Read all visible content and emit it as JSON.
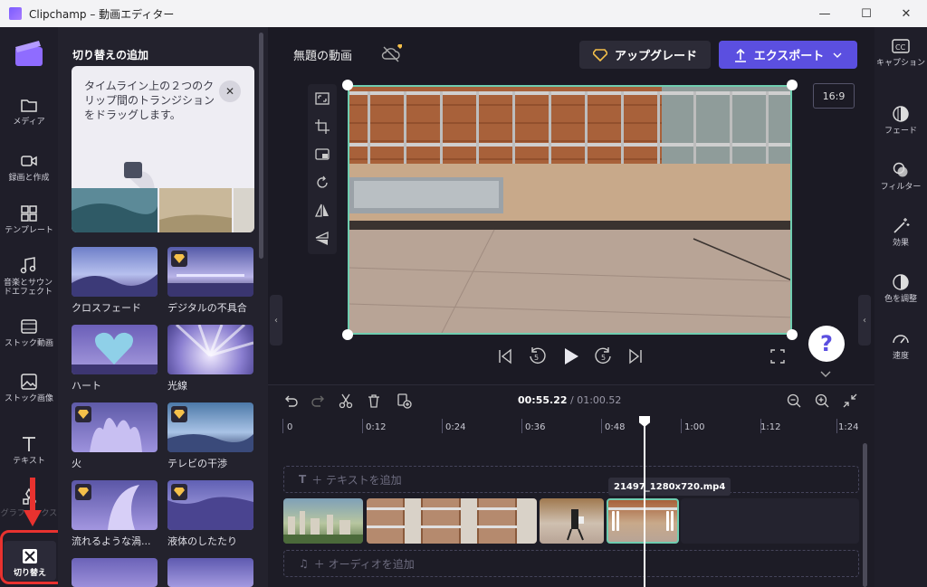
{
  "window": {
    "title": "Clipchamp – 動画エディター",
    "controls": [
      "minimize-icon",
      "maximize-icon",
      "close-icon"
    ]
  },
  "leftnav": {
    "items": [
      {
        "label": "メディア",
        "icon": "folder-icon"
      },
      {
        "label": "録画と作成",
        "icon": "camera-icon"
      },
      {
        "label": "テンプレート",
        "icon": "template-icon"
      },
      {
        "label": "音楽とサウンドエフェクト",
        "icon": "music-icon"
      },
      {
        "label": "ストック動画",
        "icon": "film-icon"
      },
      {
        "label": "ストック画像",
        "icon": "image-icon"
      },
      {
        "label": "テキスト",
        "icon": "text-icon"
      },
      {
        "label": "グラフィックス",
        "icon": "graphics-icon"
      },
      {
        "label": "切り替え",
        "icon": "transitions-icon",
        "active": true
      }
    ]
  },
  "panel": {
    "title": "切り替えの追加",
    "tip": {
      "text": "タイムライン上の２つのクリップ間のトランジションをドラッグします。"
    },
    "transitions": [
      {
        "label": "クロスフェード",
        "premium": false
      },
      {
        "label": "デジタルの不具合",
        "premium": true
      },
      {
        "label": "ハート",
        "premium": false
      },
      {
        "label": "光線",
        "premium": false
      },
      {
        "label": "火",
        "premium": true
      },
      {
        "label": "テレビの干渉",
        "premium": true
      },
      {
        "label": "流れるような渦...",
        "premium": true
      },
      {
        "label": "液体のしたたり",
        "premium": true
      }
    ]
  },
  "header": {
    "project_name": "無題の動画",
    "upgrade_label": "アップグレード",
    "export_label": "エクスポート",
    "aspect_ratio": "16:9"
  },
  "preview_tools": [
    "fit-icon",
    "crop-icon",
    "pip-icon",
    "rotate-icon",
    "flip-horizontal-icon",
    "flip-vertical-icon"
  ],
  "playback": {
    "buttons": [
      "skip-back-icon",
      "rewind-5-icon",
      "play-icon",
      "forward-5-icon",
      "skip-forward-icon",
      "fullscreen-icon"
    ],
    "help_label": "?"
  },
  "rightbar": {
    "items": [
      {
        "label": "キャプション",
        "icon": "cc-icon"
      },
      {
        "label": "フェード",
        "icon": "fade-icon"
      },
      {
        "label": "フィルター",
        "icon": "filter-icon"
      },
      {
        "label": "効果",
        "icon": "effects-icon"
      },
      {
        "label": "色を調整",
        "icon": "color-icon"
      },
      {
        "label": "速度",
        "icon": "speed-icon"
      }
    ]
  },
  "timeline": {
    "current_time": "00:55.22",
    "separator": " / ",
    "total_time": "01:00.52",
    "ruler": [
      "0",
      "0:12",
      "0:24",
      "0:36",
      "0:48",
      "1:00",
      "1:12",
      "1:24"
    ],
    "text_track_label": "＋ テキストを追加",
    "audio_track_label": "＋ オーディオを追加",
    "selected_clip_name": "21497_1280x720.mp4"
  },
  "colors": {
    "accent": "#5b4fe0",
    "selection": "#6fcdb0",
    "highlight_annotation": "#e8322f"
  }
}
